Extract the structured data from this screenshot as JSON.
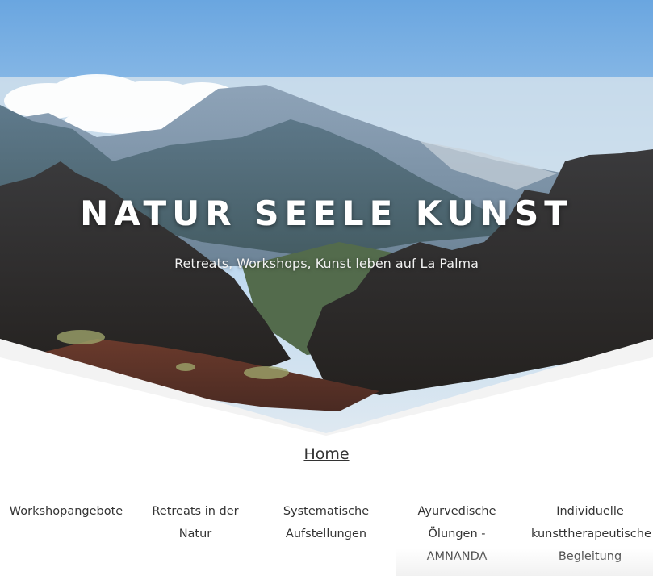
{
  "header": {
    "title": "NATUR SEELE KUNST",
    "tagline": "Retreats, Workshops, Kunst leben auf La Palma"
  },
  "nav": {
    "home_label": "Home",
    "items": [
      {
        "label": "Workshopangebote"
      },
      {
        "label": "Retreats in der Natur"
      },
      {
        "label": "Systematische Aufstellungen"
      },
      {
        "label": "Ayurvedische Ölungen - AMNANDA"
      },
      {
        "label": "Individuelle kunsttherapeutische Begleitung"
      }
    ]
  },
  "colors": {
    "sky_top": "#6aa8e0",
    "text": "#333333",
    "title": "#ffffff"
  }
}
